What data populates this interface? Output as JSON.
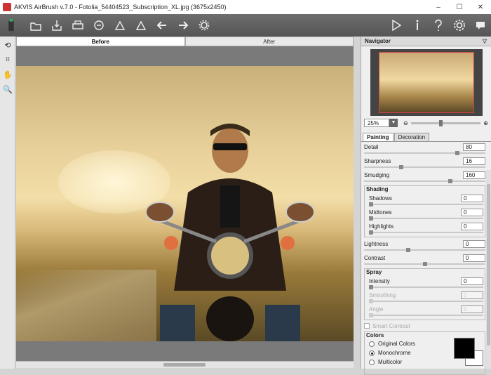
{
  "window": {
    "title": "AKVIS AirBrush v.7.0 - Fotolia_54404523_Subscription_XL.jpg (3675x2450)",
    "minimize": "–",
    "maximize": "☐",
    "close": "✕"
  },
  "toolbar": {
    "left": [
      "open-icon",
      "save-icon",
      "print-icon",
      "share-icon",
      "batch-icon",
      "preset-icon",
      "back-icon",
      "forward-icon",
      "settings-gear-icon"
    ],
    "right": [
      "run-icon",
      "info-icon",
      "help-icon",
      "preferences-icon",
      "chat-icon"
    ]
  },
  "left_tools": [
    "before-after-icon",
    "crop-icon",
    "hand-icon",
    "zoom-icon"
  ],
  "view_tabs": {
    "before": "Before",
    "after": "After"
  },
  "navigator": {
    "title": "Navigator",
    "zoom": "25%"
  },
  "panel_tabs": {
    "painting": "Painting",
    "decoration": "Decoration"
  },
  "params": {
    "detail": {
      "label": "Detail",
      "value": "80",
      "level": 0.8
    },
    "sharpness": {
      "label": "Sharpness",
      "value": "16",
      "level": 0.4
    },
    "smudging": {
      "label": "Smudging",
      "value": "160",
      "level": 0.8
    },
    "shading": {
      "title": "Shading",
      "shadows": {
        "label": "Shadows",
        "value": "0"
      },
      "midtones": {
        "label": "Midtones",
        "value": "0"
      },
      "highlights": {
        "label": "Highlights",
        "value": "0"
      }
    },
    "lightness": {
      "label": "Lightness",
      "value": "0"
    },
    "contrast": {
      "label": "Contrast",
      "value": "0"
    },
    "spray": {
      "title": "Spray",
      "intensity": {
        "label": "Intensity",
        "value": "0"
      },
      "smoothing": {
        "label": "Smoothing",
        "value": "0"
      },
      "angle": {
        "label": "Angle",
        "value": "0"
      }
    },
    "smart_contrast": "Smart Contrast"
  },
  "colors": {
    "title": "Colors",
    "options": [
      "Original Colors",
      "Monochrome",
      "Multicolor"
    ],
    "selected": "Monochrome",
    "foreground": "#000000",
    "background": "#ffffff"
  }
}
